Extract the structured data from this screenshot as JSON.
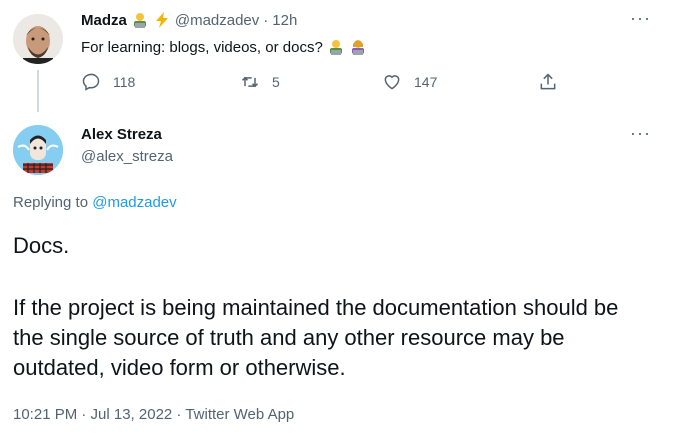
{
  "parent_tweet": {
    "display_name": "Madza",
    "handle": "@madzadev",
    "time": "12h",
    "text": "For learning: blogs, videos, or docs?",
    "stats": {
      "replies": "118",
      "retweets": "5",
      "likes": "147"
    },
    "emoji_name": [
      "technologist-icon",
      "lightning-icon"
    ]
  },
  "reply_tweet": {
    "display_name": "Alex Streza",
    "handle": "@alex_streza",
    "replying_prefix": "Replying to",
    "replying_handle": "@madzadev",
    "paragraph1": "Docs.",
    "paragraph2": "If the project is being maintained the documentation should be the single source of truth and any other resource may be outdated, video form or otherwise.",
    "meta": "10:21 PM · Jul 13, 2022 · Twitter Web App"
  },
  "colors": {
    "accent": "#1d9bf0",
    "text": "#0f1419",
    "muted": "#536471",
    "line": "#cfd9de"
  }
}
